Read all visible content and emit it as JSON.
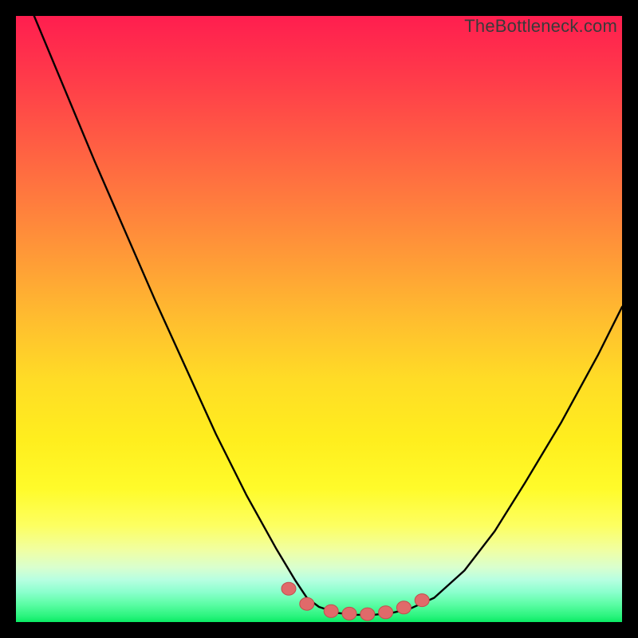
{
  "watermark": "TheBottleneck.com",
  "colors": {
    "frame": "#000000",
    "curve": "#000000",
    "marker_fill": "#e06a6a",
    "marker_stroke": "#c24e4e",
    "gradient_top": "#ff1e4f",
    "gradient_bottom": "#0aeb64"
  },
  "chart_data": {
    "type": "line",
    "title": "",
    "xlabel": "",
    "ylabel": "",
    "xlim": [
      0,
      100
    ],
    "ylim": [
      0,
      100
    ],
    "grid": false,
    "series": [
      {
        "name": "bottleneck-curve",
        "x": [
          3,
          8,
          13,
          18,
          23,
          28,
          33,
          38,
          43,
          46,
          48,
          50,
          53,
          56,
          59,
          62,
          65,
          69,
          74,
          79,
          84,
          90,
          96,
          100
        ],
        "y": [
          100,
          88,
          76,
          64.5,
          53,
          42,
          31,
          21,
          12,
          7,
          4,
          2.5,
          1.5,
          1.2,
          1.2,
          1.5,
          2.2,
          4,
          8.5,
          15,
          23,
          33,
          44,
          52
        ]
      }
    ],
    "annotations": {
      "markers": {
        "name": "optimal-range",
        "x": [
          45,
          48,
          52,
          55,
          58,
          61,
          64,
          67
        ],
        "y": [
          5.5,
          3.0,
          1.8,
          1.4,
          1.3,
          1.6,
          2.4,
          3.6
        ]
      }
    }
  }
}
